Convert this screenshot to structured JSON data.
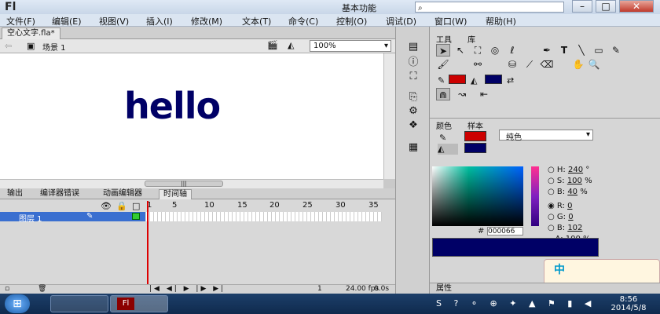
{
  "app": {
    "logo": "Fl",
    "workspace": "基本功能",
    "win": {
      "minimize": "–",
      "restore": "□",
      "close": "✕"
    }
  },
  "menu": [
    "文件(F)",
    "编辑(E)",
    "视图(V)",
    "插入(I)",
    "修改(M)",
    "文本(T)",
    "命令(C)",
    "控制(O)",
    "调试(D)",
    "窗口(W)",
    "帮助(H)"
  ],
  "document": {
    "tab": "空心文字.fla*",
    "scene": "场景 1",
    "zoom": "100%",
    "stage_text": "hello"
  },
  "timeline": {
    "tabs": [
      "输出",
      "编译器错误",
      "动画编辑器",
      "时间轴"
    ],
    "layer": "图层 1",
    "ruler": [
      "1",
      "5",
      "10",
      "15",
      "20",
      "25",
      "30",
      "35"
    ],
    "frame": "1",
    "fps": "24.00 fps",
    "time": "0.0s"
  },
  "tools": {
    "tabs": [
      "工具",
      "库"
    ]
  },
  "color": {
    "tabs": [
      "颜色",
      "样本"
    ],
    "fill_type": "纯色",
    "stroke_color": "#cc0000",
    "fill_color": "#000066",
    "H": "240",
    "S": "100",
    "B": "40",
    "R": "0",
    "G": "0",
    "Bv": "102",
    "A": "100",
    "hex": "000066",
    "h_unit": "°",
    "pct": "%",
    "hex_label": "#"
  },
  "properties": {
    "label": "属性"
  },
  "ime": {
    "label": "中"
  },
  "taskbar": {
    "time": "8:56",
    "date": "2014/5/8"
  }
}
